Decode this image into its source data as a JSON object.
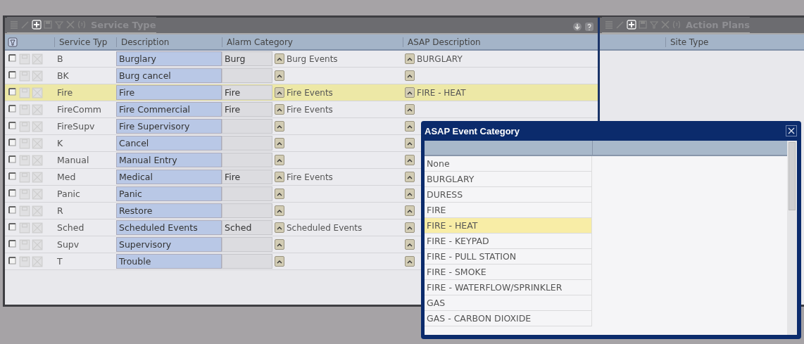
{
  "left_panel": {
    "title": "Service Type",
    "columns": [
      "Service Typ",
      "Description",
      "Alarm Category",
      "ASAP Description"
    ]
  },
  "rows": [
    {
      "service_type": "B",
      "description": "Burglary",
      "alarm_code": "Burg",
      "alarm_category": "Burg Events",
      "asap": "BURGLARY",
      "selected": false
    },
    {
      "service_type": "BK",
      "description": "Burg cancel",
      "alarm_code": "",
      "alarm_category": "",
      "asap": "",
      "selected": false
    },
    {
      "service_type": "Fire",
      "description": "Fire",
      "alarm_code": "Fire",
      "alarm_category": "Fire Events",
      "asap": "FIRE - HEAT",
      "selected": true
    },
    {
      "service_type": "FireComm",
      "description": "Fire Commercial",
      "alarm_code": "Fire",
      "alarm_category": "Fire Events",
      "asap": "",
      "selected": false
    },
    {
      "service_type": "FireSupv",
      "description": "Fire Supervisory",
      "alarm_code": "",
      "alarm_category": "",
      "asap": "",
      "selected": false
    },
    {
      "service_type": "K",
      "description": "Cancel",
      "alarm_code": "",
      "alarm_category": "",
      "asap": "",
      "selected": false
    },
    {
      "service_type": "Manual",
      "description": "Manual Entry",
      "alarm_code": "",
      "alarm_category": "",
      "asap": "",
      "selected": false
    },
    {
      "service_type": "Med",
      "description": "Medical",
      "alarm_code": "Fire",
      "alarm_category": "Fire Events",
      "asap": "",
      "selected": false
    },
    {
      "service_type": "Panic",
      "description": "Panic",
      "alarm_code": "",
      "alarm_category": "",
      "asap": "",
      "selected": false
    },
    {
      "service_type": "R",
      "description": "Restore",
      "alarm_code": "",
      "alarm_category": "",
      "asap": "",
      "selected": false
    },
    {
      "service_type": "Sched",
      "description": "Scheduled Events",
      "alarm_code": "Sched",
      "alarm_category": "Scheduled Events",
      "asap": "",
      "selected": false
    },
    {
      "service_type": "Supv",
      "description": "Supervisory",
      "alarm_code": "",
      "alarm_category": "",
      "asap": "",
      "selected": false
    },
    {
      "service_type": "T",
      "description": "Trouble",
      "alarm_code": "",
      "alarm_category": "",
      "asap": "",
      "selected": false
    }
  ],
  "right_panel": {
    "title": "Action Plans",
    "columns": [
      "Site Type"
    ]
  },
  "popup": {
    "title": "ASAP Event Category",
    "items": [
      {
        "label": "None",
        "selected": false
      },
      {
        "label": "BURGLARY",
        "selected": false
      },
      {
        "label": "DURESS",
        "selected": false
      },
      {
        "label": "FIRE",
        "selected": false
      },
      {
        "label": "FIRE - HEAT",
        "selected": true
      },
      {
        "label": "FIRE - KEYPAD",
        "selected": false
      },
      {
        "label": "FIRE - PULL STATION",
        "selected": false
      },
      {
        "label": "FIRE - SMOKE",
        "selected": false
      },
      {
        "label": "FIRE - WATERFLOW/SPRINKLER",
        "selected": false
      },
      {
        "label": "GAS",
        "selected": false
      },
      {
        "label": "GAS - CARBON DIOXIDE",
        "selected": false
      }
    ]
  }
}
